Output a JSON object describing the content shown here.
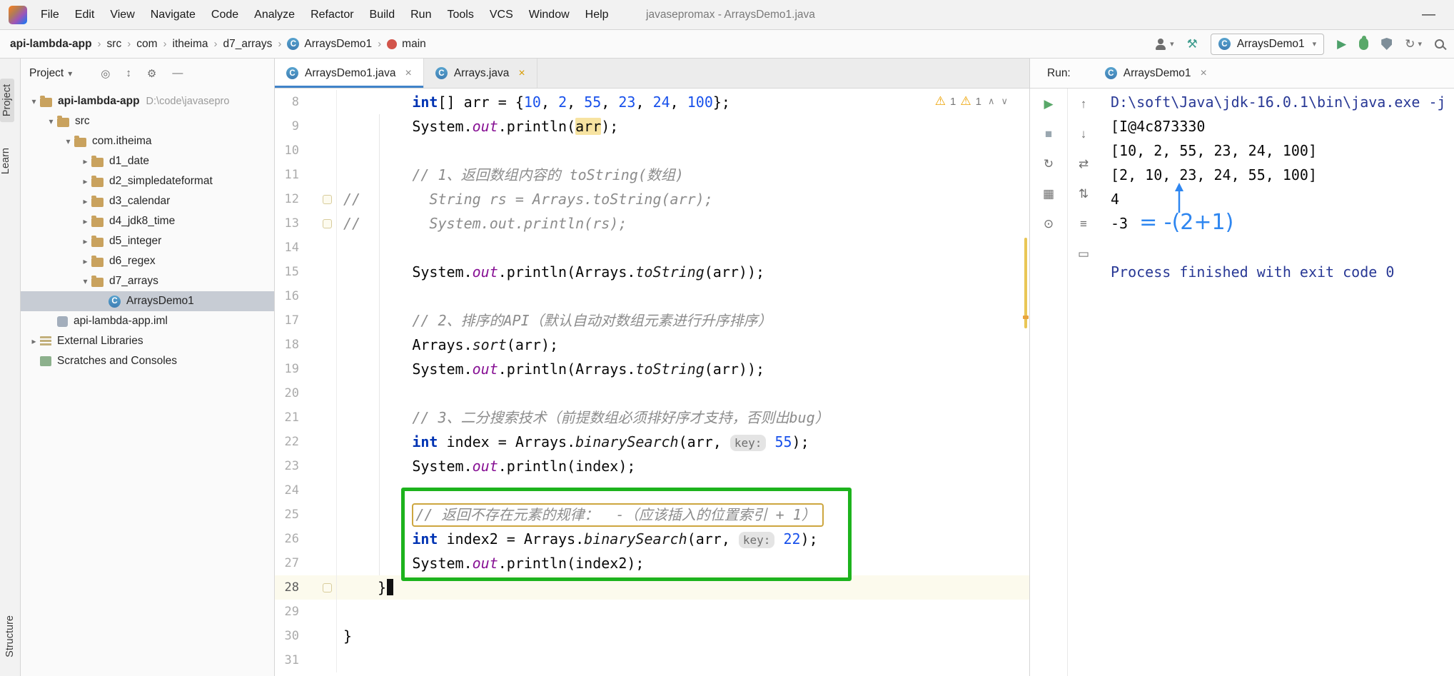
{
  "colors": {
    "annotation_green": "#1DB31D",
    "annotation_blue": "#2E86F0",
    "comment_box_yellow": "#CDA63F",
    "warning_yellow": "#EDA200",
    "active_tab_underline": "#4083C9"
  },
  "glyphs": {
    "play": "▶",
    "stop": "■",
    "rerun": "↻",
    "grid": "▦",
    "pin": "⊙",
    "up": "↑",
    "down": "↓",
    "swap": "⇄",
    "updown": "⇅",
    "menu": "≡",
    "box": "▭",
    "gear": "⚙",
    "target": "◎",
    "collapse": "↕",
    "minus": "—",
    "chev_down": "▾",
    "chev_right": "▸",
    "sep": "›",
    "warning": "⚠",
    "caret_up": "∧",
    "caret_down": "∨",
    "close": "×",
    "hammer": "⚒",
    "class_letter": "C",
    "dropdown": "▾"
  },
  "window": {
    "title": "javasepromax - ArraysDemo1.java",
    "menu": [
      "File",
      "Edit",
      "View",
      "Navigate",
      "Code",
      "Analyze",
      "Refactor",
      "Build",
      "Run",
      "Tools",
      "VCS",
      "Window",
      "Help"
    ]
  },
  "navbar": {
    "breadcrumbs": [
      {
        "label": "api-lambda-app",
        "bold": true
      },
      {
        "label": "src"
      },
      {
        "label": "com"
      },
      {
        "label": "itheima"
      },
      {
        "label": "d7_arrays"
      },
      {
        "label": "ArraysDemo1",
        "icon": "class"
      },
      {
        "label": "main",
        "icon": "method"
      }
    ],
    "run_config": "ArraysDemo1"
  },
  "left_strip": {
    "top": [
      "Project",
      "Learn"
    ],
    "bottom": [
      "Structure"
    ]
  },
  "project_panel": {
    "title": "Project",
    "tree": [
      {
        "depth": 0,
        "chevron": "open",
        "icon": "folder",
        "label": "api-lambda-app",
        "suffix": "D:\\code\\javasepro",
        "bold": true
      },
      {
        "depth": 1,
        "chevron": "open",
        "icon": "folder",
        "label": "src"
      },
      {
        "depth": 2,
        "chevron": "open",
        "icon": "package",
        "label": "com.itheima"
      },
      {
        "depth": 3,
        "chevron": "closed",
        "icon": "package",
        "label": "d1_date"
      },
      {
        "depth": 3,
        "chevron": "closed",
        "icon": "package",
        "label": "d2_simpledateformat"
      },
      {
        "depth": 3,
        "chevron": "closed",
        "icon": "package",
        "label": "d3_calendar"
      },
      {
        "depth": 3,
        "chevron": "closed",
        "icon": "package",
        "label": "d4_jdk8_time"
      },
      {
        "depth": 3,
        "chevron": "closed",
        "icon": "package",
        "label": "d5_integer"
      },
      {
        "depth": 3,
        "chevron": "closed",
        "icon": "package",
        "label": "d6_regex"
      },
      {
        "depth": 3,
        "chevron": "open",
        "icon": "package",
        "label": "d7_arrays"
      },
      {
        "depth": 4,
        "chevron": "none",
        "icon": "class",
        "label": "ArraysDemo1",
        "selected": true
      },
      {
        "depth": 1,
        "chevron": "none",
        "icon": "iml",
        "label": "api-lambda-app.iml"
      },
      {
        "depth": 0,
        "chevron": "closed",
        "icon": "library",
        "label": "External Libraries"
      },
      {
        "depth": 0,
        "chevron": "none",
        "icon": "scratch",
        "label": "Scratches and Consoles"
      }
    ]
  },
  "tabs": [
    {
      "label": "ArraysDemo1.java",
      "icon": "class",
      "active": true,
      "modified": false
    },
    {
      "label": "Arrays.java",
      "icon": "class",
      "active": false,
      "modified": true
    }
  ],
  "editor": {
    "first_line": 8,
    "inspections": [
      "1",
      "1"
    ],
    "lines": [
      {
        "num": 8,
        "tokens": [
          {
            "t": "        ",
            "c": "pl"
          },
          {
            "t": "int",
            "c": "kw"
          },
          {
            "t": "[] arr = {",
            "c": "pl"
          },
          {
            "t": "10",
            "c": "num"
          },
          {
            "t": ", ",
            "c": "pl"
          },
          {
            "t": "2",
            "c": "num"
          },
          {
            "t": ", ",
            "c": "pl"
          },
          {
            "t": "55",
            "c": "num"
          },
          {
            "t": ", ",
            "c": "pl"
          },
          {
            "t": "23",
            "c": "num"
          },
          {
            "t": ", ",
            "c": "pl"
          },
          {
            "t": "24",
            "c": "num"
          },
          {
            "t": ", ",
            "c": "pl"
          },
          {
            "t": "100",
            "c": "num"
          },
          {
            "t": "};",
            "c": "pl"
          }
        ]
      },
      {
        "num": 9,
        "tokens": [
          {
            "t": "        System.",
            "c": "pl"
          },
          {
            "t": "out",
            "c": "field"
          },
          {
            "t": ".println(",
            "c": "pl"
          },
          {
            "t": "arr",
            "c": "pl hl"
          },
          {
            "t": ");",
            "c": "pl"
          }
        ]
      },
      {
        "num": 10,
        "tokens": []
      },
      {
        "num": 11,
        "tokens": [
          {
            "t": "        // 1、返回数组内容的 toString(数组)",
            "c": "cmt"
          }
        ]
      },
      {
        "num": 12,
        "fold": true,
        "tokens": [
          {
            "t": "//        String rs = Arrays.toString(arr);",
            "c": "cmt"
          }
        ]
      },
      {
        "num": 13,
        "fold": true,
        "tokens": [
          {
            "t": "//        System.out.println(rs);",
            "c": "cmt"
          }
        ]
      },
      {
        "num": 14,
        "tokens": []
      },
      {
        "num": 15,
        "tokens": [
          {
            "t": "        System.",
            "c": "pl"
          },
          {
            "t": "out",
            "c": "field"
          },
          {
            "t": ".println(Arrays.",
            "c": "pl"
          },
          {
            "t": "toString",
            "c": "smethod"
          },
          {
            "t": "(arr));",
            "c": "pl"
          }
        ]
      },
      {
        "num": 16,
        "tokens": []
      },
      {
        "num": 17,
        "tokens": [
          {
            "t": "        // 2、排序的API（默认自动对数组元素进行升序排序）",
            "c": "cmt"
          }
        ]
      },
      {
        "num": 18,
        "tokens": [
          {
            "t": "        Arrays.",
            "c": "pl"
          },
          {
            "t": "sort",
            "c": "smethod"
          },
          {
            "t": "(arr);",
            "c": "pl"
          }
        ]
      },
      {
        "num": 19,
        "tokens": [
          {
            "t": "        System.",
            "c": "pl"
          },
          {
            "t": "out",
            "c": "field"
          },
          {
            "t": ".println(Arrays.",
            "c": "pl"
          },
          {
            "t": "toString",
            "c": "smethod"
          },
          {
            "t": "(arr));",
            "c": "pl"
          }
        ]
      },
      {
        "num": 20,
        "tokens": []
      },
      {
        "num": 21,
        "tokens": [
          {
            "t": "        // 3、二分搜索技术（前提数组必须排好序才支持，否则出bug）",
            "c": "cmt"
          }
        ]
      },
      {
        "num": 22,
        "tokens": [
          {
            "t": "        ",
            "c": "pl"
          },
          {
            "t": "int",
            "c": "kw"
          },
          {
            "t": " index = Arrays.",
            "c": "pl"
          },
          {
            "t": "binarySearch",
            "c": "smethod"
          },
          {
            "t": "(arr, ",
            "c": "pl"
          },
          {
            "t": "key:",
            "c": "hint"
          },
          {
            "t": " ",
            "c": "pl"
          },
          {
            "t": "55",
            "c": "num"
          },
          {
            "t": ");",
            "c": "pl"
          }
        ]
      },
      {
        "num": 23,
        "tokens": [
          {
            "t": "        System.",
            "c": "pl"
          },
          {
            "t": "out",
            "c": "field"
          },
          {
            "t": ".println(index);",
            "c": "pl"
          }
        ]
      },
      {
        "num": 24,
        "tokens": []
      },
      {
        "num": 25,
        "tokens": [
          {
            "t": "        ",
            "c": "pl"
          },
          {
            "t": "// 返回不存在元素的规律：  -（应该插入的位置索引 + 1）",
            "c": "cmt boxed"
          }
        ]
      },
      {
        "num": 26,
        "tokens": [
          {
            "t": "        ",
            "c": "pl"
          },
          {
            "t": "int",
            "c": "kw"
          },
          {
            "t": " index2 = Arrays.",
            "c": "pl"
          },
          {
            "t": "binarySearch",
            "c": "smethod"
          },
          {
            "t": "(arr, ",
            "c": "pl"
          },
          {
            "t": "key:",
            "c": "hint"
          },
          {
            "t": " ",
            "c": "pl"
          },
          {
            "t": "22",
            "c": "num"
          },
          {
            "t": ");",
            "c": "pl"
          }
        ]
      },
      {
        "num": 27,
        "tokens": [
          {
            "t": "        System.",
            "c": "pl"
          },
          {
            "t": "out",
            "c": "field"
          },
          {
            "t": ".println(index2);",
            "c": "pl"
          }
        ]
      },
      {
        "num": 28,
        "current": true,
        "fold": true,
        "caret": true,
        "tokens": [
          {
            "t": "    }",
            "c": "pl"
          }
        ]
      },
      {
        "num": 29,
        "tokens": []
      },
      {
        "num": 30,
        "tokens": [
          {
            "t": "}",
            "c": "pl"
          }
        ]
      },
      {
        "num": 31,
        "tokens": []
      }
    ]
  },
  "run_panel": {
    "header_label": "Run:",
    "tab": {
      "label": "ArraysDemo1"
    },
    "toolbar_a": [
      {
        "name": "rerun-button",
        "glyph": "play",
        "color": "green"
      },
      {
        "name": "stop-button",
        "glyph": "stop",
        "color": "gray"
      },
      {
        "name": "restore-layout-button",
        "glyph": "rerun"
      },
      {
        "name": "layout-options-button",
        "glyph": "grid"
      },
      {
        "name": "pin-tab-button",
        "glyph": "pin"
      }
    ],
    "toolbar_b": [
      {
        "name": "up-stack-trace-button",
        "glyph": "up"
      },
      {
        "name": "down-stack-trace-button",
        "glyph": "down"
      },
      {
        "name": "soft-wrap-button",
        "glyph": "swap"
      },
      {
        "name": "scroll-to-end-button",
        "glyph": "updown"
      },
      {
        "name": "print-button",
        "glyph": "menu"
      },
      {
        "name": "clear-all-button",
        "glyph": "box"
      }
    ],
    "console": [
      {
        "text": "D:\\soft\\Java\\jdk-16.0.1\\bin\\java.exe -j",
        "cls": "sys"
      },
      {
        "text": "[I@4c873330",
        "cls": "std"
      },
      {
        "text": "[10, 2, 55, 23, 24, 100]",
        "cls": "std"
      },
      {
        "text": "[2, 10, 23, 24, 55, 100]",
        "cls": "std"
      },
      {
        "text": "4",
        "cls": "std"
      },
      {
        "text": "-3",
        "cls": "std",
        "annotation": "= -(2+1)"
      },
      {
        "text": "",
        "cls": "std"
      },
      {
        "text": "Process finished with exit code 0",
        "cls": "sys"
      }
    ]
  }
}
